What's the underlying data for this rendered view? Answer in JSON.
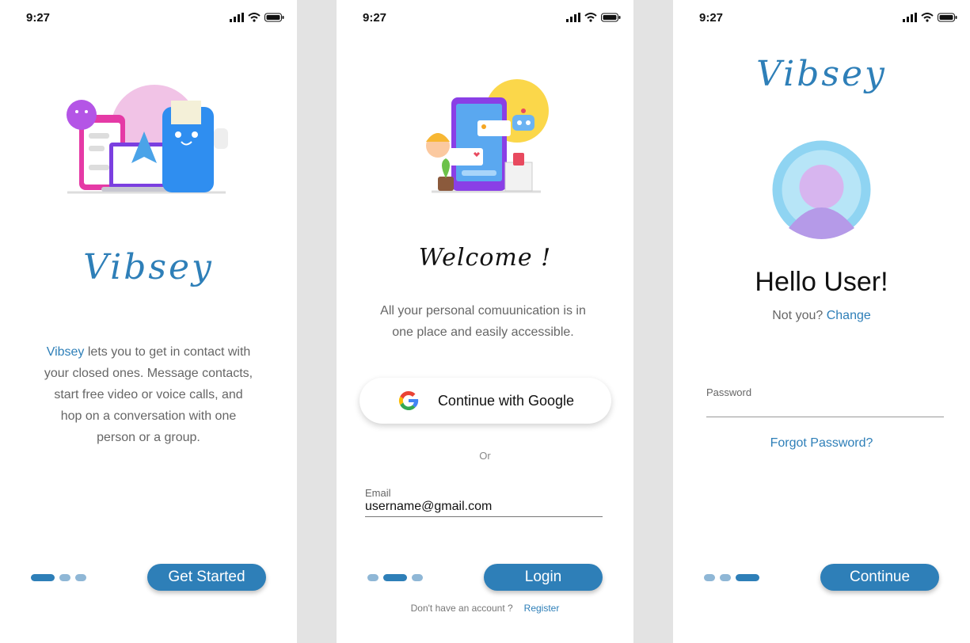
{
  "status": {
    "time": "9:27"
  },
  "screen1": {
    "brand": "Vibsey",
    "desc_highlight": "Vibsey",
    "desc_rest": " lets you to get in contact with your closed ones. Message contacts, start free video or voice calls, and hop on a conversation with one person or a group.",
    "button": "Get Started"
  },
  "screen2": {
    "title": "Welcome !",
    "desc": "All your personal comuunication is in one place and easily accessible.",
    "google_button": "Continue with Google",
    "or": "Or",
    "email_label": "Email",
    "email_value": "username@gmail.com",
    "button": "Login",
    "no_account": "Don't have an account ?",
    "register": "Register"
  },
  "screen3": {
    "brand": "Vibsey",
    "hello": "Hello User!",
    "not_you": "Not you?",
    "change": "Change",
    "password_label": "Password",
    "forgot": "Forgot Password?",
    "button": "Continue"
  },
  "colors": {
    "accent": "#2e7fb8",
    "dot_inactive": "#8fb7d6",
    "gutter": "#e3e3e3"
  }
}
